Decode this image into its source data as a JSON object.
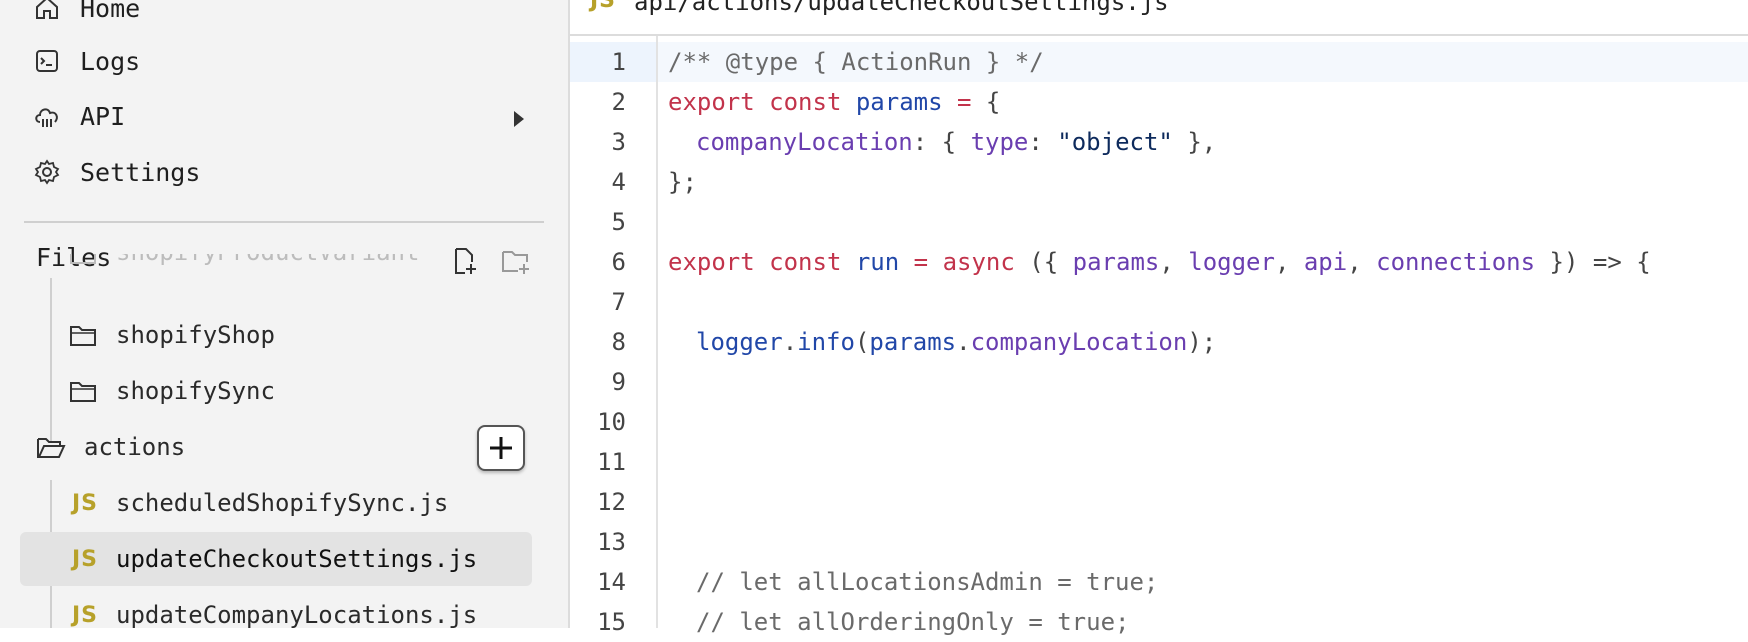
{
  "nav": {
    "items": [
      {
        "label": "Home",
        "icon": "home-icon"
      },
      {
        "label": "Logs",
        "icon": "terminal-icon"
      },
      {
        "label": "API",
        "icon": "cloud-icon"
      },
      {
        "label": "Settings",
        "icon": "gear-icon"
      }
    ]
  },
  "files": {
    "title": "Files",
    "tree": [
      {
        "label": "shopifyProductVariant",
        "kind": "folder"
      },
      {
        "label": "shopifyShop",
        "kind": "folder"
      },
      {
        "label": "shopifySync",
        "kind": "folder"
      },
      {
        "label": "actions",
        "kind": "folder-open"
      },
      {
        "label": "scheduledShopifySync.js",
        "kind": "js",
        "badge": "JS"
      },
      {
        "label": "updateCheckoutSettings.js",
        "kind": "js",
        "badge": "JS",
        "selected": true
      },
      {
        "label": "updateCompanyLocations.js",
        "kind": "js",
        "badge": "JS"
      }
    ]
  },
  "editor": {
    "tab": {
      "badge": "JS",
      "path": "api/actions/updateCheckoutSettings.js"
    },
    "line_numbers": [
      "1",
      "2",
      "3",
      "4",
      "5",
      "6",
      "7",
      "8",
      "9",
      "10",
      "11",
      "12",
      "13",
      "14",
      "15"
    ],
    "code": {
      "l1": "/** @type { ActionRun } */",
      "l2": [
        "export",
        "const",
        "params",
        "=",
        "{"
      ],
      "l3": [
        "companyLocation",
        ": {",
        "type",
        ":",
        "\"object\"",
        "},"
      ],
      "l4": "};",
      "l6": [
        "export",
        "const",
        "run",
        "=",
        "async",
        "({",
        "params",
        ",",
        "logger",
        ",",
        "api",
        ",",
        "connections",
        "}) => {"
      ],
      "l8": [
        "logger",
        ".",
        "info",
        "(",
        "params",
        ".",
        "companyLocation",
        ");"
      ],
      "l14": "// let allLocationsAdmin = true;",
      "l15": "// let allOrderingOnly = true;"
    }
  },
  "colors": {
    "keyword": "#c2334b",
    "variable": "#2147a8",
    "property": "#6a3eb0",
    "string": "#0d2a5c",
    "comment": "#6a6a6a",
    "js_badge": "#b7a12a"
  }
}
